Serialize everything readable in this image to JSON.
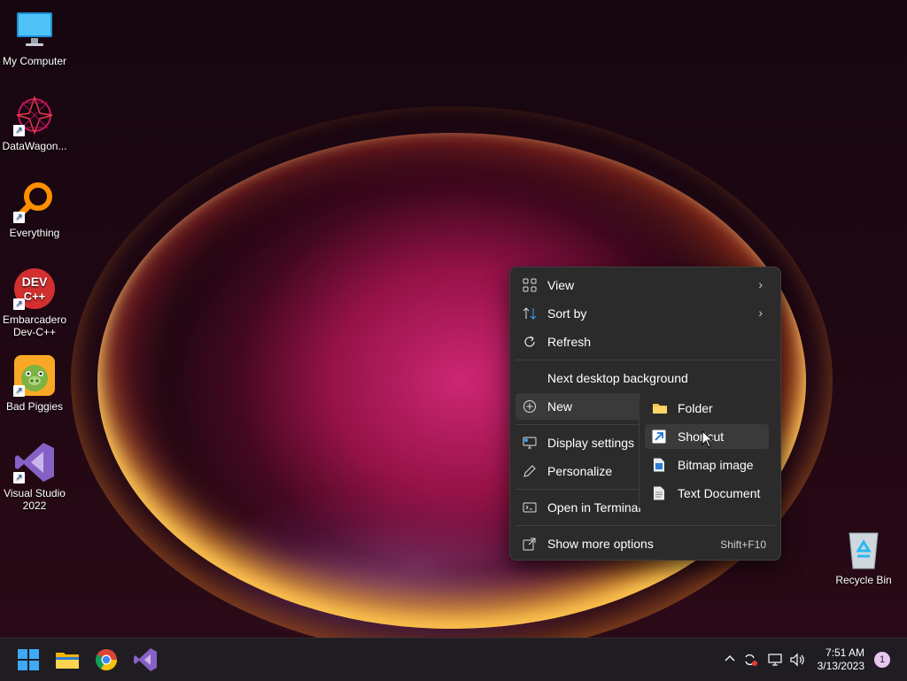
{
  "desktop": {
    "icons": [
      {
        "label": "My Computer"
      },
      {
        "label": "DataWagon..."
      },
      {
        "label": "Everything"
      },
      {
        "label": "Embarcadero Dev-C++"
      },
      {
        "label": "Bad Piggies"
      },
      {
        "label": "Visual Studio 2022"
      },
      {
        "label": "Recycle Bin"
      }
    ],
    "devcpp_text": {
      "line1": "DEV",
      "line2": "C++"
    }
  },
  "context_menu": {
    "items": [
      {
        "label": "View",
        "icon": "grid-icon",
        "has_submenu": true
      },
      {
        "label": "Sort by",
        "icon": "sort-arrows-icon",
        "has_submenu": true
      },
      {
        "label": "Refresh",
        "icon": "refresh-icon"
      },
      {
        "label": "Next desktop background"
      },
      {
        "label": "New",
        "icon": "plus-circle-icon",
        "has_submenu": true
      },
      {
        "label": "Display settings",
        "icon": "display-icon"
      },
      {
        "label": "Personalize",
        "icon": "pen-icon"
      },
      {
        "label": "Open in Terminal",
        "icon": "terminal-icon"
      },
      {
        "label": "Show more options",
        "icon": "share-icon",
        "shortcut": "Shift+F10"
      }
    ]
  },
  "new_submenu": {
    "items": [
      {
        "label": "Folder",
        "icon": "folder-icon"
      },
      {
        "label": "Shortcut",
        "icon": "shortcut-icon",
        "highlighted": true
      },
      {
        "label": "Bitmap image",
        "icon": "bitmap-icon"
      },
      {
        "label": "Text Document",
        "icon": "text-document-icon"
      }
    ]
  },
  "taskbar": {
    "apps": [
      "start-icon",
      "file-explorer-icon",
      "chrome-icon",
      "visual-studio-icon"
    ],
    "tray": [
      "chevron-up-icon",
      "sync-icon",
      "network-icon",
      "volume-icon"
    ],
    "clock": {
      "time": "7:51 AM",
      "date": "3/13/2023"
    },
    "notification_count": "1"
  },
  "colors": {
    "menu_bg": "#2b2b2b",
    "menu_highlight": "#3a3a3a",
    "taskbar_bg": "#1f1d22",
    "accent": "#0078d4"
  }
}
